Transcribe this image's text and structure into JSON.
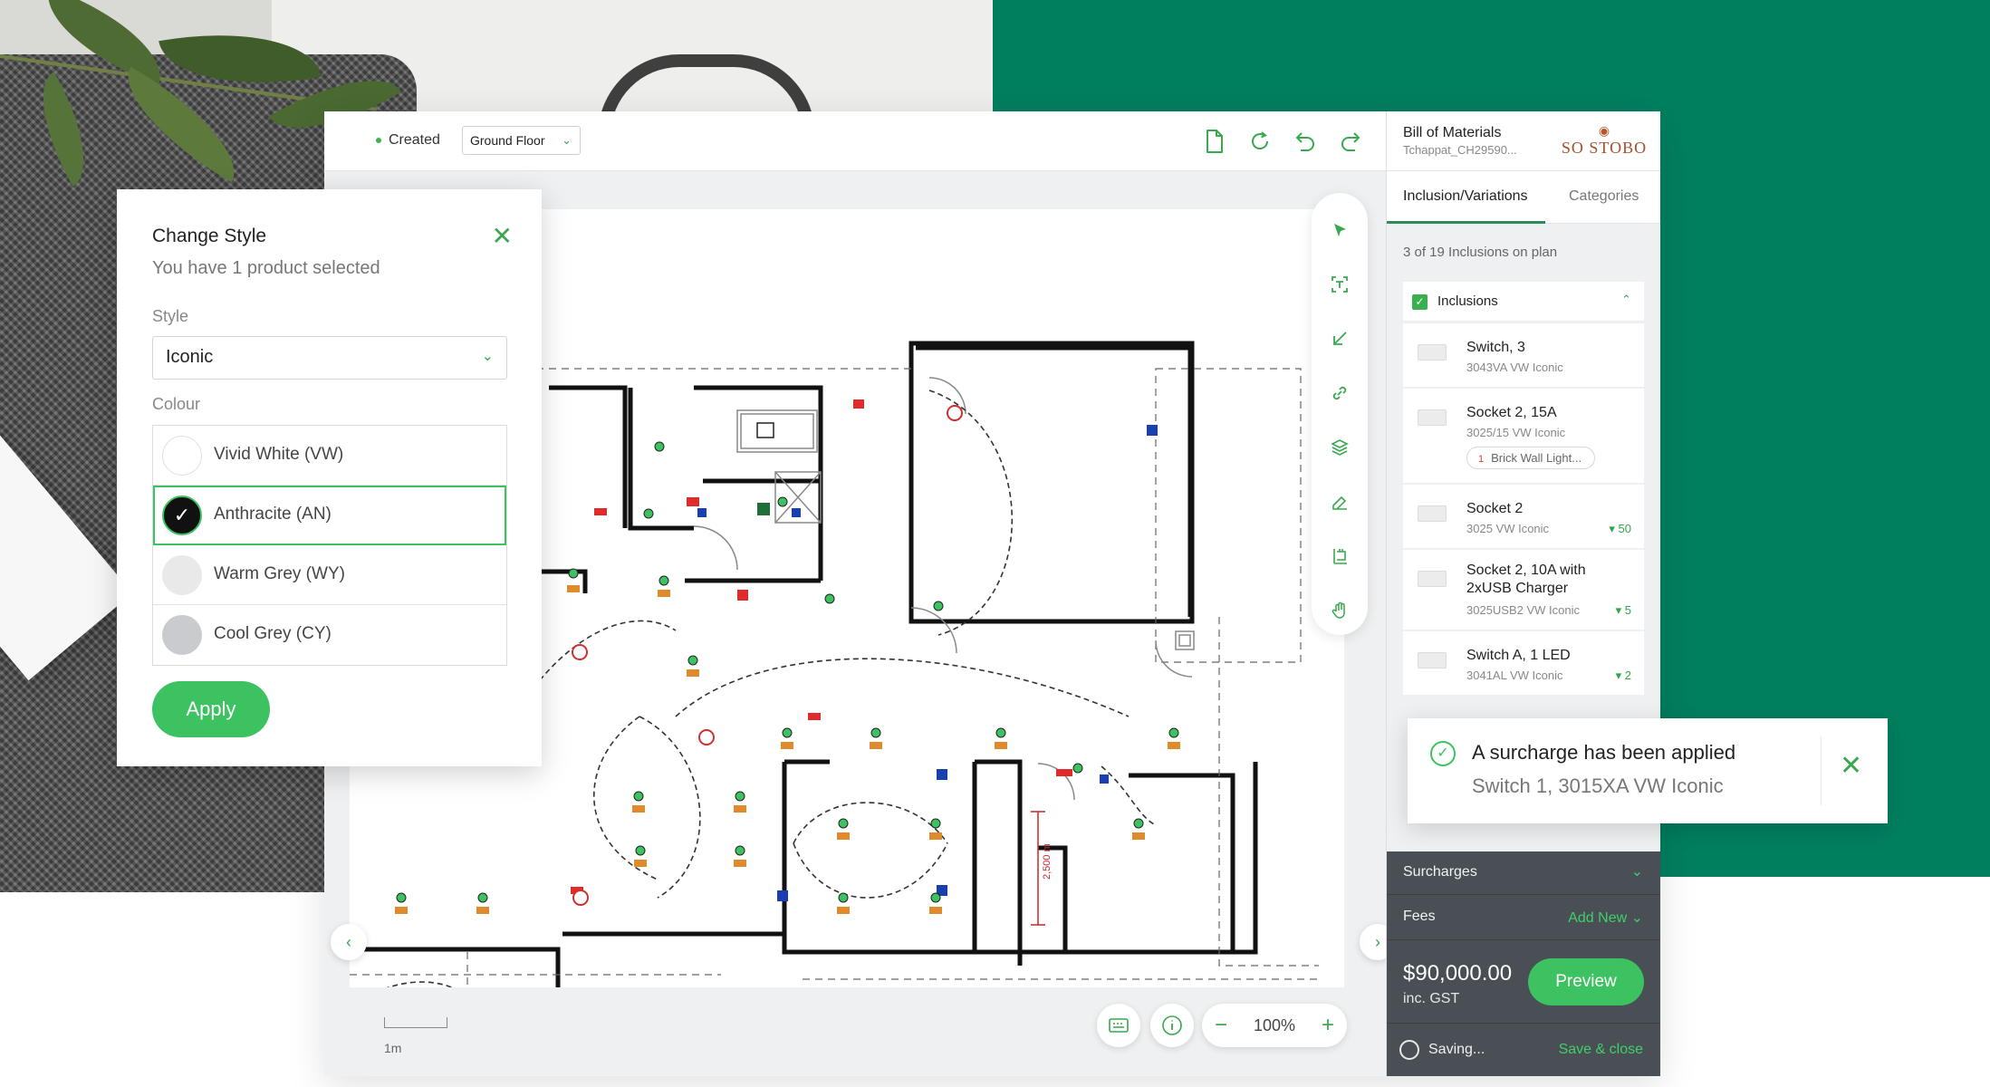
{
  "topbar": {
    "status": "Created",
    "floor": "Ground Floor"
  },
  "icons": {
    "document": "document-icon",
    "refresh": "refresh-icon",
    "undo": "undo-icon",
    "redo": "redo-icon",
    "select": "pointer-icon",
    "text": "text-tool-icon",
    "arrow": "arrow-tool-icon",
    "link": "link-icon",
    "layers": "layers-icon",
    "eraser": "eraser-icon",
    "measure": "measure-icon",
    "hand": "hand-icon"
  },
  "right_panel": {
    "title": "Bill of Materials",
    "subtitle": "Tchappat_CH29590...",
    "logo_text": "SO STOBO",
    "tabs": [
      {
        "label": "Inclusion/Variations",
        "active": true
      },
      {
        "label": "Categories",
        "active": false
      }
    ],
    "count_text": "3 of 19 Inclusions on plan",
    "group_label": "Inclusions",
    "items": [
      {
        "name": "Switch, 3",
        "code": "3043VA  VW  Iconic",
        "qty": ""
      },
      {
        "name": "Socket 2, 15A",
        "code": "3025/15  VW  Iconic",
        "qty": "",
        "tag_num": "1",
        "tag": "Brick Wall Light..."
      },
      {
        "name": "Socket 2",
        "code": "3025  VW  Iconic",
        "qty": "50"
      },
      {
        "name": "Socket 2, 10A with",
        "name2": "2xUSB Charger",
        "code": "3025USB2  VW  Iconic",
        "qty": "5"
      },
      {
        "name": "Switch A, 1 LED",
        "code": "3041AL  VW  Iconic",
        "qty": "2"
      }
    ],
    "surcharges_label": "Surcharges",
    "fees_label": "Fees",
    "fees_action": "Add New",
    "total": "$90,000.00",
    "total_sub": "inc. GST",
    "preview_label": "Preview",
    "saving_label": "Saving...",
    "save_close_label": "Save & close"
  },
  "modal": {
    "title": "Change Style",
    "subtitle": "You have 1 product selected",
    "style_label": "Style",
    "style_value": "Iconic",
    "colour_label": "Colour",
    "colours": [
      {
        "name": "Vivid White (VW)",
        "swatch": "#ffffff",
        "selected": false
      },
      {
        "name": "Anthracite (AN)",
        "swatch": "#111111",
        "selected": true
      },
      {
        "name": "Warm Grey (WY)",
        "swatch": "#e9e9ea",
        "selected": false
      },
      {
        "name": "Cool Grey (CY)",
        "swatch": "#c9cbce",
        "selected": false
      }
    ],
    "apply_label": "Apply"
  },
  "toast": {
    "title": "A surcharge has been applied",
    "subtitle": "Switch 1, 3015XA VW Iconic"
  },
  "bottom": {
    "scale_label": "1m",
    "zoom": "100%",
    "plan_dimension": "2,500 m"
  },
  "colors": {
    "accent_green": "#3cc260",
    "brand_green": "#007f5f",
    "panel_dark": "#4a4f55",
    "warning_red": "#d32f2f"
  }
}
